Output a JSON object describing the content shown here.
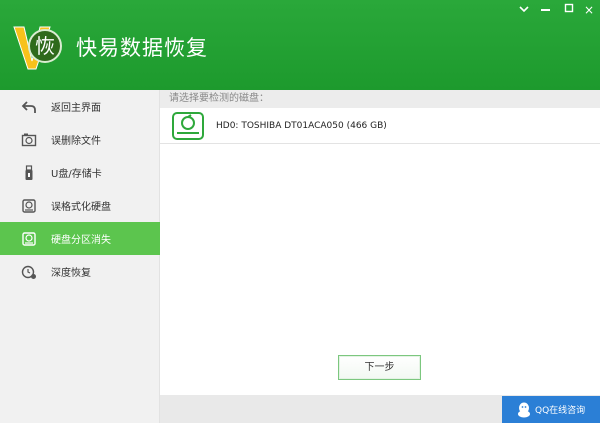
{
  "window": {
    "title": "快易数据恢复",
    "logo_char": "恢",
    "minimize_icon": "minimize-icon",
    "menu_icon": "chevron-down-icon",
    "close_label": "×"
  },
  "sidebar": {
    "items": [
      {
        "label": "返回主界面",
        "icon": "return-arrow-icon",
        "active": false
      },
      {
        "label": "误删除文件",
        "icon": "recycle-bin-icon",
        "active": false
      },
      {
        "label": "U盘/存储卡",
        "icon": "usb-drive-icon",
        "active": false
      },
      {
        "label": "误格式化硬盘",
        "icon": "hard-drive-icon",
        "active": false
      },
      {
        "label": "硬盘分区消失",
        "icon": "disk-partition-icon",
        "active": true
      },
      {
        "label": "深度恢复",
        "icon": "deep-scan-icon",
        "active": false
      }
    ]
  },
  "main": {
    "prompt": "请选择要检测的磁盘：",
    "disks": [
      {
        "label": "HD0: TOSHIBA DT01ACA050 (466 GB)",
        "icon": "disk-icon"
      }
    ],
    "next_label": "下一步"
  },
  "footer": {
    "qq_label": "QQ在线咨询"
  },
  "colors": {
    "brand_green": "#1d9a2d",
    "active_green": "#5cc54e",
    "qq_blue": "#2b7fd6"
  }
}
